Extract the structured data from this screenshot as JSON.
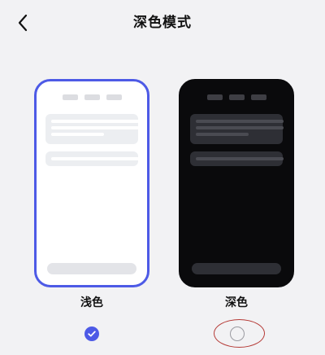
{
  "header": {
    "title": "深色模式",
    "back_icon": "chevron-left-icon"
  },
  "modes": [
    {
      "label": "浅色",
      "selected": true
    },
    {
      "label": "深色",
      "selected": false
    }
  ],
  "colors": {
    "accent": "#4d5ae6",
    "background": "#f2f2f4",
    "dark_preview": "#0a0a0c",
    "annotation": "#b53a36"
  }
}
